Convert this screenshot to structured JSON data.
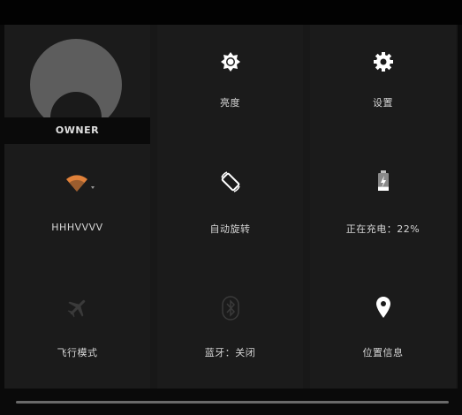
{
  "owner": {
    "name": "OWNER"
  },
  "tiles": {
    "brightness": {
      "label": "亮度",
      "icon": "brightness-icon"
    },
    "settings": {
      "label": "设置",
      "icon": "gear-icon"
    },
    "wifi": {
      "label": "HHHVVVV",
      "icon": "wifi-icon",
      "color": "#e0813a"
    },
    "auto_rotate": {
      "label": "自动旋转",
      "icon": "rotate-icon"
    },
    "battery": {
      "label": "正在充电：22%",
      "icon": "battery-charging-icon",
      "level": 0.22
    },
    "airplane": {
      "label": "飞行模式",
      "icon": "airplane-icon",
      "enabled": false
    },
    "bluetooth": {
      "label": "蓝牙：关闭",
      "icon": "bluetooth-icon",
      "enabled": false
    },
    "location": {
      "label": "位置信息",
      "icon": "location-pin-icon"
    }
  }
}
